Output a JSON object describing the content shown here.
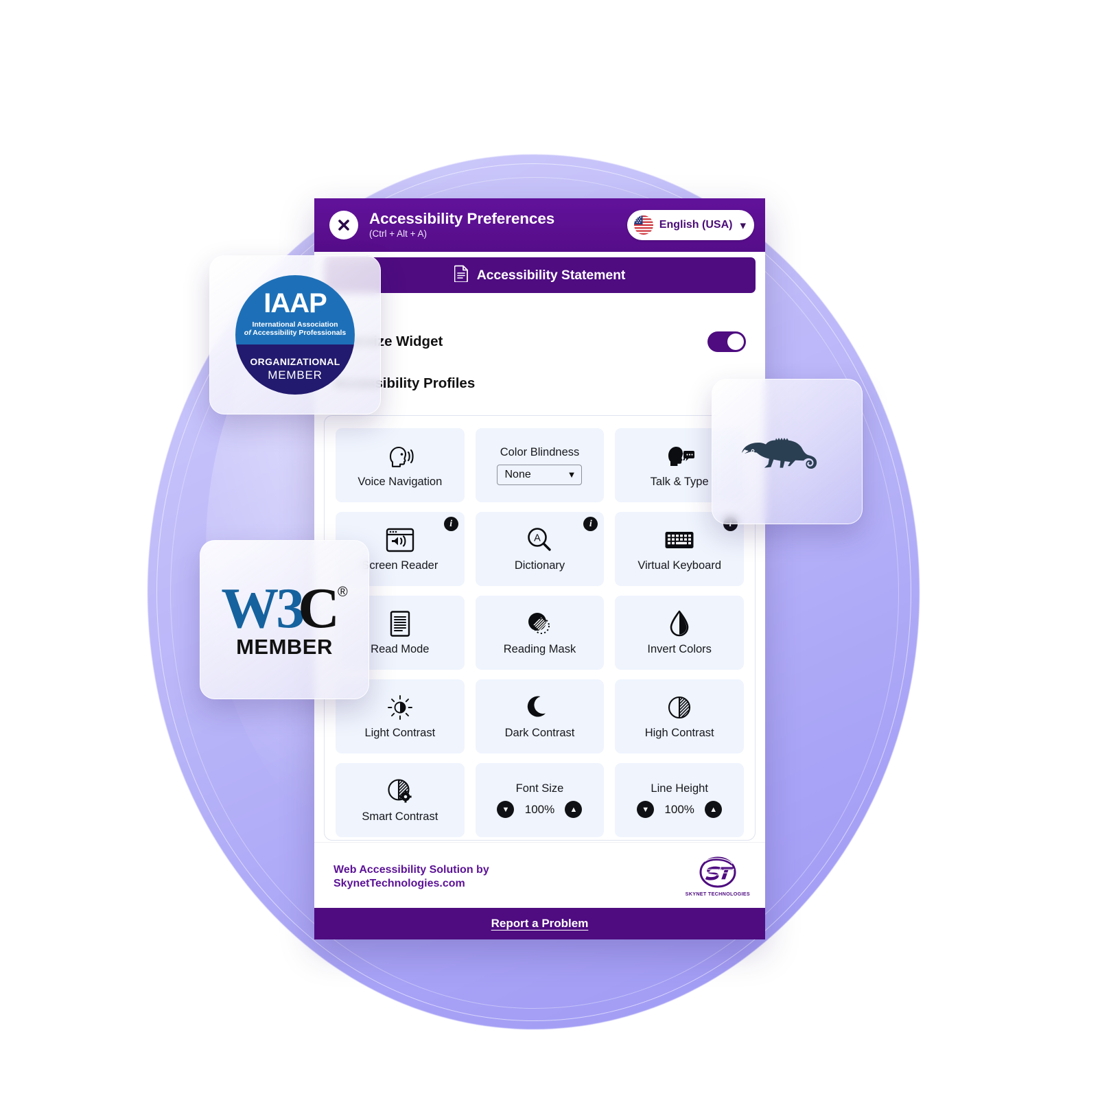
{
  "theme": {
    "brand_purple": "#4e0c80",
    "header_purple": "#5b0f8f",
    "tile_bg": "#eff4fd",
    "footer_link_purple": "#5b1296",
    "blob_gradient_start": "#cfccfb",
    "blob_gradient_end": "#9f99f5"
  },
  "header": {
    "close_icon": "close-x-icon",
    "title": "Accessibility Preferences",
    "shortcut": "(Ctrl + Alt + A)",
    "language": {
      "flag_icon": "usa-flag-icon",
      "label": "English (USA)",
      "chevron_icon": "chevron-down-icon"
    }
  },
  "statement_button": {
    "icon": "document-icon",
    "label": "Accessibility Statement"
  },
  "settings": {
    "oversize_widget_label": "Oversize Widget",
    "oversize_widget_on": true,
    "profiles_label": "Accessibility Profiles"
  },
  "grid": {
    "tiles": [
      {
        "label": "Voice Navigation",
        "icon": "speaking-head-icon",
        "type": "icon",
        "info": false
      },
      {
        "label": "Color Blindness",
        "icon": "none",
        "type": "select",
        "info": false,
        "select_value": "None",
        "select_caret": "caret-down-icon"
      },
      {
        "label": "Talk & Type",
        "icon": "talk-type-icon",
        "type": "icon",
        "info": false
      },
      {
        "label": "Screen Reader",
        "icon": "screen-reader-icon",
        "type": "icon",
        "info": true
      },
      {
        "label": "Dictionary",
        "icon": "dictionary-search-icon",
        "type": "icon",
        "info": true
      },
      {
        "label": "Virtual Keyboard",
        "icon": "keyboard-icon",
        "type": "icon",
        "info": true
      },
      {
        "label": "Read Mode",
        "icon": "document-lines-icon",
        "type": "icon",
        "info": false
      },
      {
        "label": "Reading Mask",
        "icon": "reading-mask-icon",
        "type": "icon",
        "info": false
      },
      {
        "label": "Invert Colors",
        "icon": "droplet-half-icon",
        "type": "icon",
        "info": false
      },
      {
        "label": "Light Contrast",
        "icon": "sun-half-icon",
        "type": "icon",
        "info": false
      },
      {
        "label": "Dark Contrast",
        "icon": "moon-icon",
        "type": "icon",
        "info": false
      },
      {
        "label": "High Contrast",
        "icon": "circle-half-hatched-icon",
        "type": "icon",
        "info": false
      },
      {
        "label": "Smart Contrast",
        "icon": "circle-half-gear-icon",
        "type": "icon",
        "info": false
      },
      {
        "label": "Font Size",
        "icon": "none",
        "type": "stepper",
        "info": false,
        "value": "100%",
        "decrease_icon": "chevron-down-circle-icon",
        "increase_icon": "chevron-up-circle-icon"
      },
      {
        "label": "Line Height",
        "icon": "none",
        "type": "stepper",
        "info": false,
        "value": "100%",
        "decrease_icon": "chevron-down-circle-icon",
        "increase_icon": "chevron-up-circle-icon"
      }
    ]
  },
  "footer": {
    "line1": "Web Accessibility Solution by",
    "line2": "SkynetTechnologies.com",
    "logo_mark": "ST",
    "logo_name": "SKYNET TECHNOLOGIES"
  },
  "report_bar": {
    "label": "Report a Problem"
  },
  "badges": {
    "iaap": {
      "wordmark": "IAAP",
      "line1": "International Association",
      "line2_italic": "of",
      "line2": "Accessibility Professionals",
      "tier": "ORGANIZATIONAL",
      "member": "MEMBER"
    },
    "w3c": {
      "mark_blue": "W3",
      "mark_black": "C",
      "registered": "®",
      "member": "MEMBER"
    },
    "chameleon": {
      "icon": "chameleon-icon"
    }
  }
}
